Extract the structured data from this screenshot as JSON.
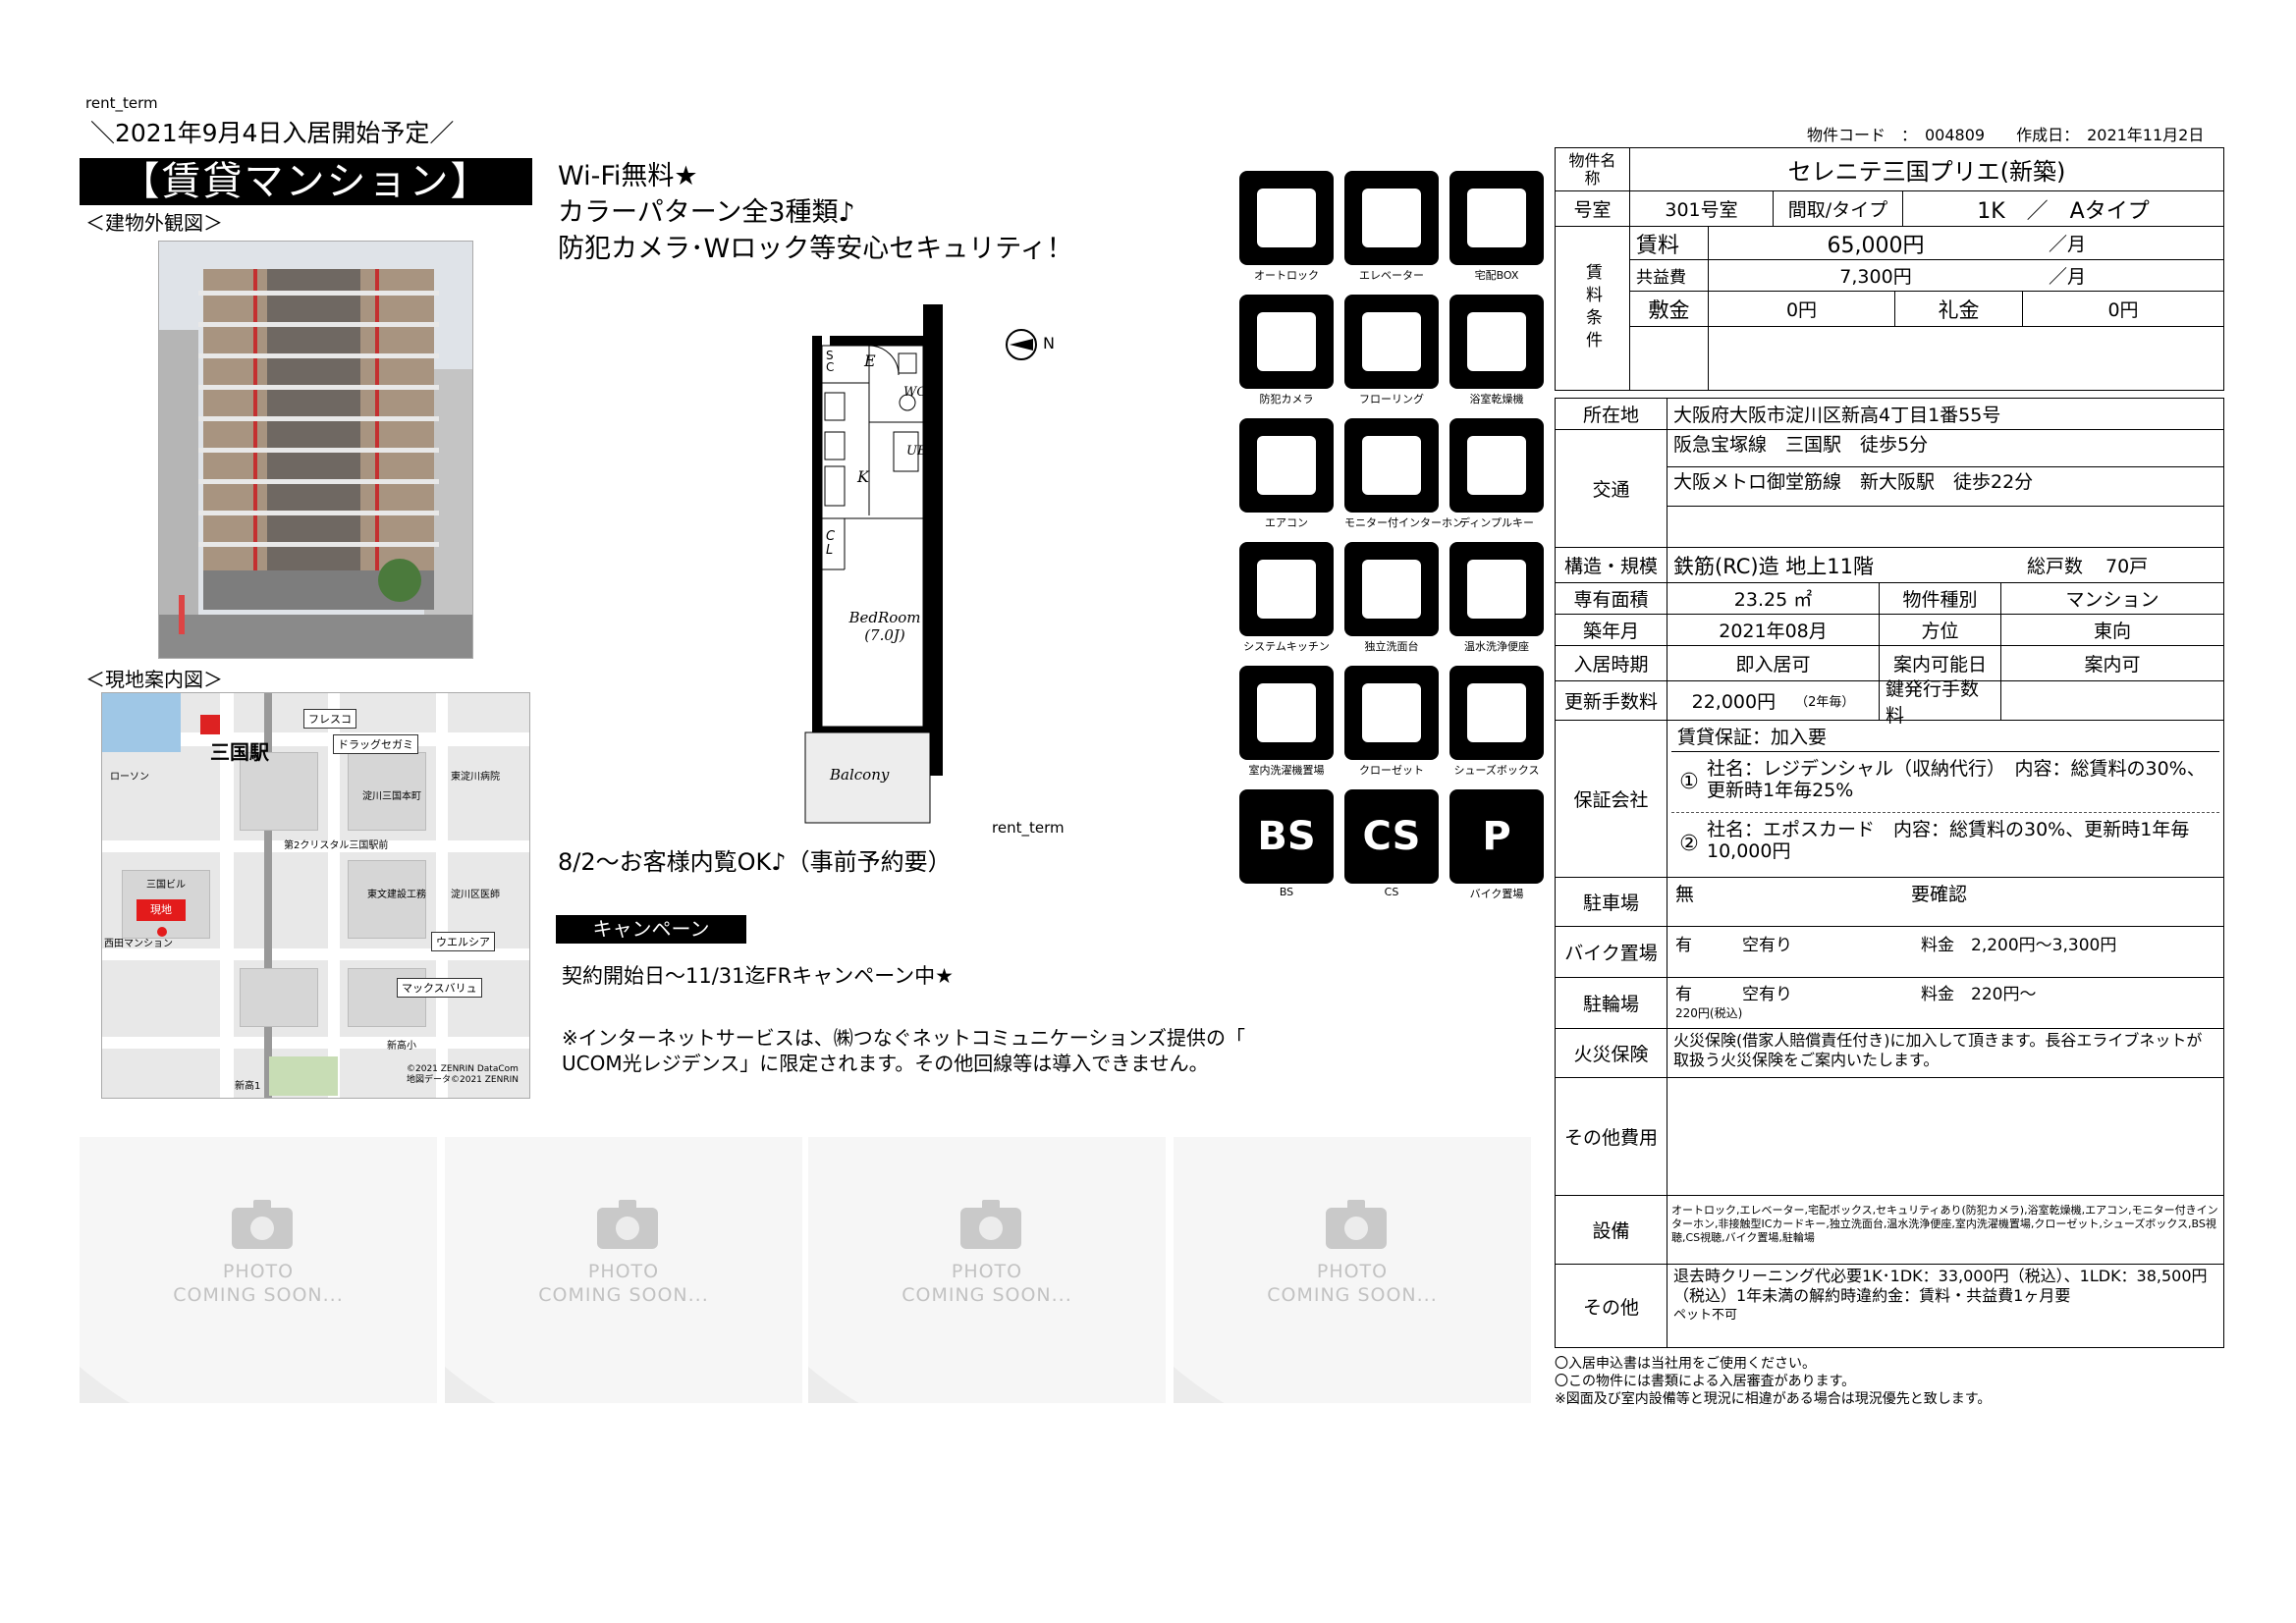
{
  "header": {
    "rent_term_top": "rent_term",
    "move_in": "＼2021年9月4日入居開始予定／",
    "property_code": "物件コード　：　004809　　作成日：　2021年11月2日"
  },
  "banner": "【賃貸マンション】",
  "labels": {
    "exterior": "＜建物外観図＞",
    "map": "＜現地案内図＞",
    "rent_term_plan": "rent_term"
  },
  "pr": {
    "line1": "Wi-Fi無料★",
    "line2": "カラーパターン全3種類♪",
    "line3": "防犯カメラ･Wロック等安心セキュリティ！",
    "viewing": "8/2～お客様内覧OK♪（事前予約要）",
    "campaign_label": "キャンペーン",
    "campaign_text": "契約開始日～11/31迄FRキャンペーン中★",
    "internet_note1": "※インターネットサービスは、㈱つなぐネットコミュニケーションズ提供の「",
    "internet_note2": "UCOM光レジデンス」に限定されます。その他回線等は導入できません。"
  },
  "map": {
    "station": "三国駅",
    "tags": [
      "フレスコ",
      "ドラッグセガミ",
      "ウエルシア",
      "マックスバリュ"
    ],
    "here": "現地",
    "copyright1": "©2021 ZENRIN DataCom",
    "copyright2": "地図データ©2021 ZENRIN",
    "area1": "東淀川病院",
    "area2": "淀川三国本町",
    "area3": "三国ビル",
    "area4": "淀川区医師",
    "area5": "西田マンション",
    "area6": "新高1",
    "area7": "ローソン",
    "area8": "第2クリスタル三国駅前",
    "area9": "東文建設工務",
    "area10": "新高小"
  },
  "floorplan": {
    "sc": "S C",
    "e": "E",
    "wc": "WC",
    "ub": "UB",
    "k": "K",
    "cl": "C L",
    "bedroom": "BedRoom",
    "bedroom_size": "(7.0J)",
    "balcony": "Balcony",
    "north": "N"
  },
  "icons": [
    {
      "name": "intercom-icon",
      "cap": "オートロック"
    },
    {
      "name": "elevator-icon",
      "cap": "エレベーター"
    },
    {
      "name": "delivery-box-icon",
      "cap": "宅配BOX"
    },
    {
      "name": "security-camera-icon",
      "cap": "防犯カメラ"
    },
    {
      "name": "flooring-icon",
      "cap": "フローリング"
    },
    {
      "name": "bath-dryer-icon",
      "cap": "浴室乾燥機"
    },
    {
      "name": "air-conditioner-icon",
      "cap": "エアコン"
    },
    {
      "name": "monitor-intercom-icon",
      "cap": "モニター付インターホン"
    },
    {
      "name": "dimple-key-icon",
      "cap": "ディンプルキー"
    },
    {
      "name": "system-kitchen-icon",
      "cap": "システムキッチン"
    },
    {
      "name": "vanity-icon",
      "cap": "独立洗面台"
    },
    {
      "name": "washlet-icon",
      "cap": "温水洗浄便座"
    },
    {
      "name": "washing-machine-icon",
      "cap": "室内洗濯機置場"
    },
    {
      "name": "closet-icon",
      "cap": "クローゼット"
    },
    {
      "name": "shoe-box-icon",
      "cap": "シューズボックス"
    },
    {
      "name": "bs-icon",
      "cap": "BS",
      "label": "BS"
    },
    {
      "name": "cs-icon",
      "cap": "CS",
      "label": "CS"
    },
    {
      "name": "bike-parking-icon",
      "cap": "バイク置場",
      "label": "P"
    }
  ],
  "photos": {
    "t1": "PHOTO",
    "t2": "COMING SOON..."
  },
  "table": {
    "name_label": "物件名称",
    "name": "セレニテ三国プリエ(新築)",
    "room_label": "号室",
    "room": "301号室",
    "layout_label": "間取/タイプ",
    "layout": "1K　／　Aタイプ",
    "terms_label": "賃料条件",
    "rent_label": "賃料",
    "rent": "65,000円",
    "per_month": "／月",
    "fee_label": "共益費",
    "fee": "7,300円",
    "deposit_label": "敷金",
    "deposit": "0円",
    "key_money_label": "礼金",
    "key_money": "0円",
    "address_label": "所在地",
    "address": "大阪府大阪市淀川区新高4丁目1番55号",
    "transit_label": "交通",
    "transit1": "阪急宝塚線　三国駅　徒歩5分",
    "transit2": "大阪メトロ御堂筋線　新大阪駅　徒歩22分",
    "structure_label": "構造・規模",
    "structure": "鉄筋(RC)造 地上11階",
    "units_label": "総戸数",
    "units": "70戸",
    "area_label": "専有面積",
    "area": "23.25 ㎡",
    "type_label": "物件種別",
    "type": "マンション",
    "built_label": "築年月",
    "built": "2021年08月",
    "direction_label": "方位",
    "direction": "東向",
    "movein_label": "入居時期",
    "movein": "即入居可",
    "guide_label": "案内可能日",
    "guide": "案内可",
    "renewal_label": "更新手数料",
    "renewal": "22,000円",
    "renewal_period": "（2年毎）",
    "key_fee_label": "鍵発行手数料",
    "guarantor_label": "保証会社",
    "guarantor_head": "賃貸保証：加入要",
    "g1_no": "①",
    "g1": "社名：レジデンシャル（収納代行）　内容：総賃料の30%、更新時1年毎25%",
    "g2_no": "②",
    "g2": "社名：エポスカード　内容：総賃料の30%、更新時1年毎10,000円",
    "parking_label": "駐車場",
    "parking": "無",
    "parking_note": "要確認",
    "bike_label": "バイク置場",
    "bike": "有　　　空有り",
    "bike_fee": "料金　2,200円～3,300円",
    "bicycle_label": "駐輪場",
    "bicycle": "有　　　空有り",
    "bicycle_fee": "料金　220円～",
    "bicycle_note": "220円(税込)",
    "insurance_label": "火災保険",
    "insurance": "火災保険(借家人賠償責任付き)に加入して頂きます。長谷エライブネットが取扱う火災保険をご案内いたします。",
    "other_cost_label": "その他費用",
    "equip_label": "設備",
    "equip": "オートロック,エレベーター,宅配ボックス,セキュリティあり(防犯カメラ),浴室乾燥機,エアコン,モニター付きインターホン,非接触型ICカードキー,独立洗面台,温水洗浄便座,室内洗濯機置場,クローゼット,シューズボックス,BS視聴,CS視聴,バイク置場,駐輪場",
    "other_label": "その他",
    "other": "退去時クリーニング代必要1K･1DK：33,000円（税込）、1LDK：38,500円（税込）1年未満の解約時違約金：賃料・共益費1ヶ月要",
    "other2": "ペット不可"
  },
  "notes": [
    "〇入居申込書は当社用をご使用ください。",
    "〇この物件には書類による入居審査があります。",
    "※図面及び室内設備等と現況に相違がある場合は現況優先と致します。"
  ]
}
